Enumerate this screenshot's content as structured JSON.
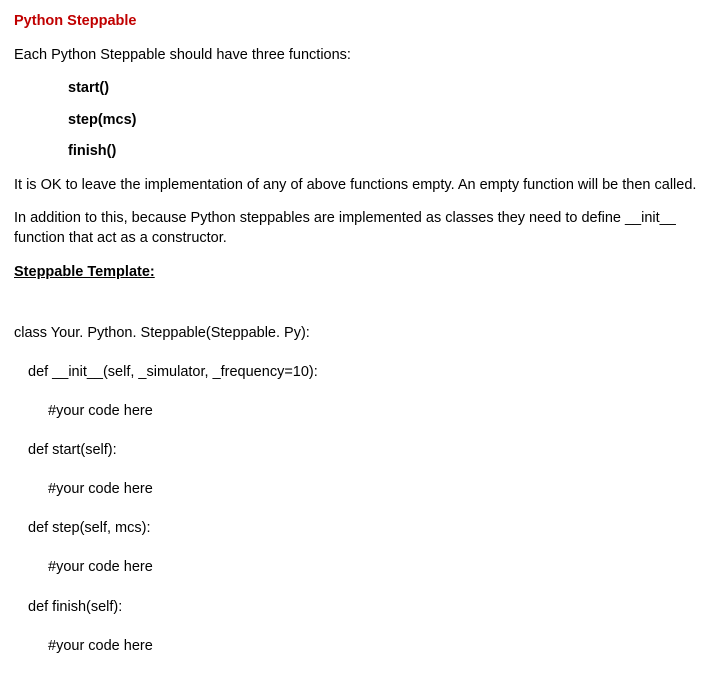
{
  "title": "Python Steppable",
  "intro": "Each Python Steppable should have three functions:",
  "functions": [
    "start()",
    "step(mcs)",
    "finish()"
  ],
  "para1": "It is OK to leave the implementation of any of above functions empty. An empty function will be then called.",
  "para2": "In addition to this, because Python steppables are implemented as classes they need to define __init__ function that act as a constructor.",
  "sectionHeader": "Steppable Template:",
  "code": {
    "l0": "class Your. Python. Steppable(Steppable. Py):",
    "l1": "def __init__(self, _simulator, _frequency=10):",
    "l2": "#your code here",
    "l3": "def start(self):",
    "l4": "#your code here",
    "l5": "def step(self, mcs):",
    "l6": "#your code here",
    "l7": "def finish(self):",
    "l8": "#your code here"
  }
}
